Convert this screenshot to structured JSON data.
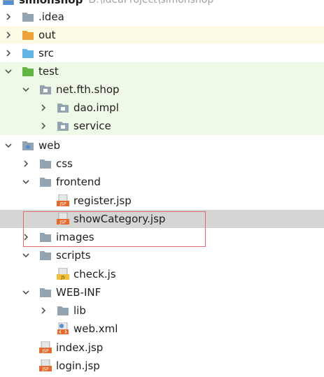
{
  "tree": {
    "root": {
      "label": "simonshop",
      "path": "D:\\IdeaProject\\simonshop"
    },
    "items": [
      {
        "label": ".idea"
      },
      {
        "label": "out"
      },
      {
        "label": "src"
      },
      {
        "label": "test"
      },
      {
        "label": "net.fth.shop"
      },
      {
        "label": "dao.impl"
      },
      {
        "label": "service"
      },
      {
        "label": "web"
      },
      {
        "label": "css"
      },
      {
        "label": "frontend"
      },
      {
        "label": "register.jsp"
      },
      {
        "label": "showCategory.jsp"
      },
      {
        "label": "images"
      },
      {
        "label": "scripts"
      },
      {
        "label": "check.js"
      },
      {
        "label": "WEB-INF"
      },
      {
        "label": "lib"
      },
      {
        "label": "web.xml"
      },
      {
        "label": "index.jsp"
      },
      {
        "label": "login.jsp"
      }
    ],
    "file_badges": {
      "jsp": "JSP",
      "js": "JS"
    }
  },
  "colors": {
    "folder": "#94a3b0",
    "folder_out": "#f0a23a",
    "folder_src": "#62b5e5",
    "folder_test": "#62b543",
    "jsp_badge": "#e46a2d",
    "js_badge": "#f2c03a",
    "highlight_border": "#e0696d"
  }
}
